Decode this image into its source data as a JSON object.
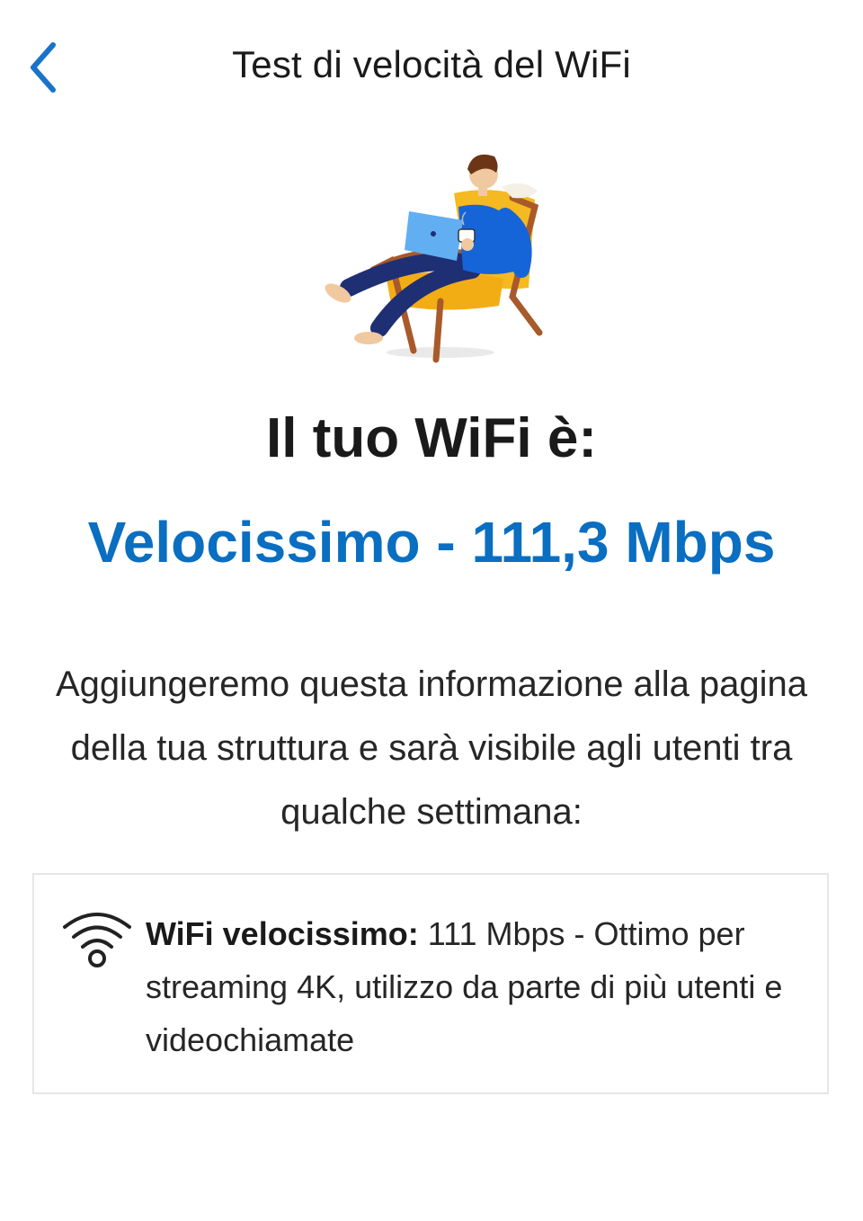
{
  "nav": {
    "title": "Test di velocità del WiFi",
    "back_icon": "chevron-left-icon"
  },
  "illustration": {
    "name": "person-relaxing-armchair-laptop-illustration"
  },
  "result": {
    "headline": "Il tuo WiFi è:",
    "speed_label": "Velocissimo - 111,3 Mbps"
  },
  "description": "Aggiungeremo questa informazione alla pagina della tua struttura e sarà visibile agli utenti tra qualche settimana:",
  "card": {
    "icon": "wifi-icon",
    "title": "WiFi velocissimo:",
    "text": "111 Mbps - Ottimo per streaming 4K, utilizzo da parte di più utenti e videochiamate"
  },
  "colors": {
    "accent": "#0a6ec1",
    "text": "#1a1a1a",
    "card_border": "#e6e6e6"
  }
}
